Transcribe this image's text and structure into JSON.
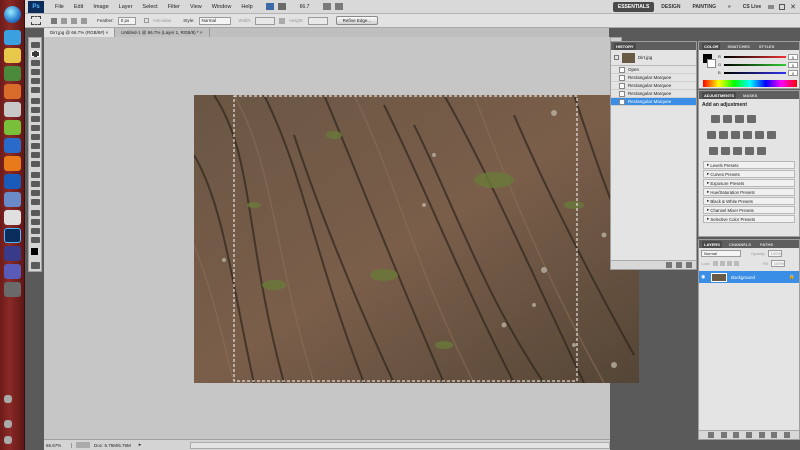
{
  "menubar": {
    "logo": "Ps",
    "items": [
      "File",
      "Edit",
      "Image",
      "Layer",
      "Select",
      "Filter",
      "View",
      "Window",
      "Help"
    ],
    "zoom": "66.7",
    "workspaces": [
      "ESSENTIALS",
      "DESIGN",
      "PAINTING"
    ],
    "cs_live": "CS Live"
  },
  "options": {
    "feather_label": "Feather:",
    "feather_value": "0 px",
    "antialias_label": "Anti-alias",
    "style_label": "Style:",
    "style_value": "Normal",
    "width_label": "Width:",
    "height_label": "Height:",
    "refine_edge": "Refine Edge..."
  },
  "document_tabs": [
    {
      "label": "Dirt.jpg @ 66.7% (RGB/8#)",
      "active": true
    },
    {
      "label": "Untitled-1 @ 66.7% (Layer 1, RGB/8) *",
      "active": false
    }
  ],
  "statusbar": {
    "zoom": "66.67%",
    "doc": "Doc: 6.75M/6.75M"
  },
  "history": {
    "tab": "HISTORY",
    "snapshot": "Dirt.jpg",
    "items": [
      "Open",
      "Rectangular Marquee",
      "Rectangular Marquee",
      "Rectangular Marquee",
      "Rectangular Marquee"
    ],
    "selected_index": 4
  },
  "color_panel": {
    "tabs": [
      "COLOR",
      "SWATCHES",
      "STYLES"
    ],
    "values": [
      "0",
      "0",
      "0"
    ],
    "colors": {
      "red": "#e33",
      "green": "#3c3",
      "blue": "#33e"
    }
  },
  "adjustments": {
    "tabs": [
      "ADJUSTMENTS",
      "MASKS"
    ],
    "title": "Add an adjustment",
    "presets": [
      "Levels Presets",
      "Curves Presets",
      "Exposure Presets",
      "Hue/Saturation Presets",
      "Black & White Presets",
      "Channel Mixer Presets",
      "Selective Color Presets"
    ]
  },
  "layers": {
    "tabs": [
      "LAYERS",
      "CHANNELS",
      "PATHS"
    ],
    "blend_mode": "Normal",
    "opacity_label": "Opacity:",
    "opacity": "100%",
    "lock_label": "Lock:",
    "fill_label": "Fill:",
    "fill": "100%",
    "layer_name": "Background"
  }
}
